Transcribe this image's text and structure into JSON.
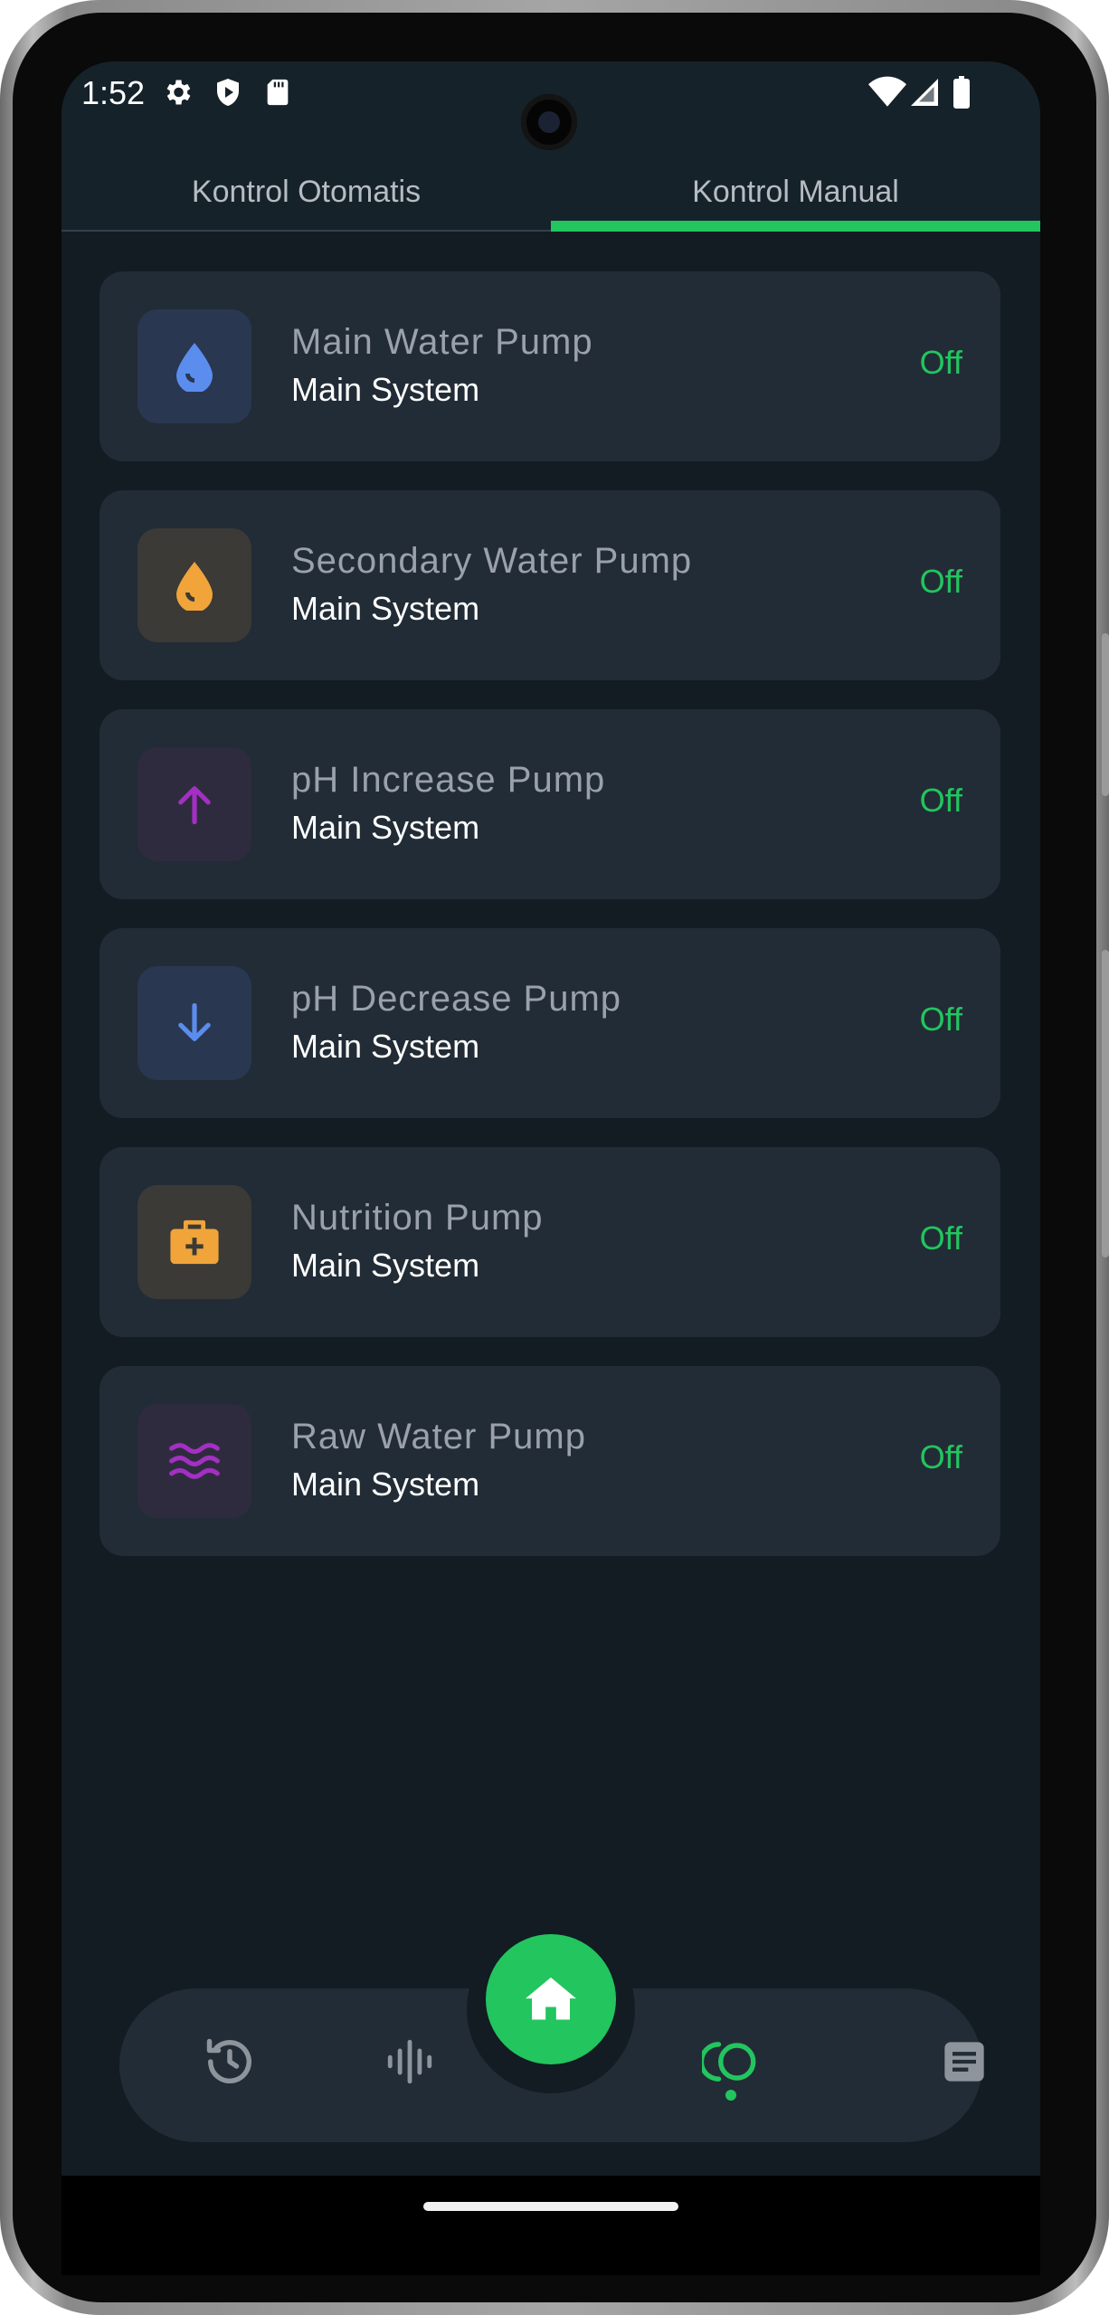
{
  "status_bar": {
    "time": "1:52"
  },
  "tabs": [
    {
      "label": "Kontrol Otomatis",
      "selected": false
    },
    {
      "label": "Kontrol Manual",
      "selected": true
    }
  ],
  "colors": {
    "accent": "#22c55e",
    "background": "#121c22",
    "card": "#222c36"
  },
  "devices": [
    {
      "name": "Main Water Pump",
      "group": "Main System",
      "state": "Off",
      "icon": "water-drop-icon"
    },
    {
      "name": "Secondary Water Pump",
      "group": "Main System",
      "state": "Off",
      "icon": "water-drop-icon"
    },
    {
      "name": "pH Increase Pump",
      "group": "Main System",
      "state": "Off",
      "icon": "arrow-up-icon"
    },
    {
      "name": "pH Decrease Pump",
      "group": "Main System",
      "state": "Off",
      "icon": "arrow-down-icon"
    },
    {
      "name": "Nutrition Pump",
      "group": "Main System",
      "state": "Off",
      "icon": "medical-kit-icon"
    },
    {
      "name": "Raw Water Pump",
      "group": "Main System",
      "state": "Off",
      "icon": "waves-icon"
    }
  ],
  "bottom_nav": {
    "items": [
      "history-icon",
      "sound-wave-icon",
      "home-icon",
      "control-icon",
      "report-icon"
    ],
    "active": "control-icon"
  }
}
